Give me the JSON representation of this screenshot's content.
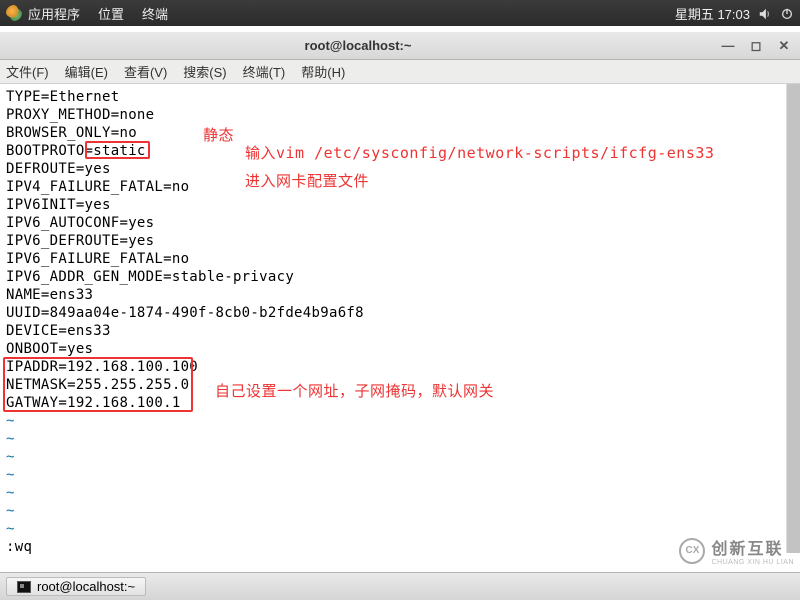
{
  "topbar": {
    "menu_apps": "应用程序",
    "menu_places": "位置",
    "menu_terminal": "终端",
    "date": "星期五 17:03"
  },
  "window": {
    "title": "root@localhost:~"
  },
  "menubar": {
    "file": "文件(F)",
    "edit": "编辑(E)",
    "view": "查看(V)",
    "search": "搜索(S)",
    "terminal": "终端(T)",
    "help": "帮助(H)"
  },
  "content": {
    "lines": [
      "TYPE=Ethernet",
      "PROXY_METHOD=none",
      "BROWSER_ONLY=no",
      "BOOTPROTO=static",
      "DEFROUTE=yes",
      "IPV4_FAILURE_FATAL=no",
      "IPV6INIT=yes",
      "IPV6_AUTOCONF=yes",
      "IPV6_DEFROUTE=yes",
      "IPV6_FAILURE_FATAL=no",
      "IPV6_ADDR_GEN_MODE=stable-privacy",
      "NAME=ens33",
      "UUID=849aa04e-1874-490f-8cb0-b2fde4b9a6f8",
      "DEVICE=ens33",
      "ONBOOT=yes",
      "IPADDR=192.168.100.100",
      "NETMASK=255.255.255.0",
      "GATWAY=192.168.100.1"
    ],
    "tilde": "~",
    "cmd": ":wq"
  },
  "annotations": {
    "static_label": "静态",
    "top_line1": "输入vim /etc/sysconfig/network-scripts/ifcfg-ens33",
    "top_line2": "进入网卡配置文件",
    "bottom": "自己设置一个网址，子网掩码，默认网关"
  },
  "taskbar": {
    "task1": "root@localhost:~"
  },
  "watermark": {
    "brand": "创新互联",
    "sub": "CHUANG XIN HU LIAN",
    "logo": "CX"
  }
}
